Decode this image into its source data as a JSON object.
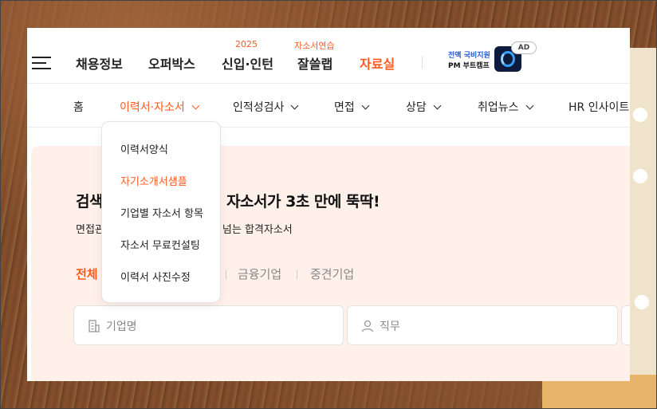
{
  "header": {
    "nav": [
      {
        "label": "채용정보",
        "tag": ""
      },
      {
        "label": "오퍼박스",
        "tag": ""
      },
      {
        "label": "신입·인턴",
        "tag": "2025"
      },
      {
        "label": "잘쓸랩",
        "tag": "자소서연습"
      },
      {
        "label": "자료실",
        "tag": ""
      }
    ],
    "ad": {
      "line1": "전액 국비지원",
      "line2": "PM 부트캠프",
      "badge": "AD"
    }
  },
  "subnav": {
    "items": [
      "홈",
      "이력서·자소서",
      "인적성검사",
      "면접",
      "상담",
      "취업뉴스",
      "HR 인사이트"
    ],
    "active_index": 1
  },
  "dropdown": {
    "items": [
      "이력서양식",
      "자기소개서샘플",
      "기업별 자소서 항목",
      "자소서 무료컨설팅",
      "이력서 사진수정"
    ],
    "active_index": 1
  },
  "hero": {
    "title_left": "검색",
    "title_right": "격 자소서가 3초 만에 뚝딱!",
    "sub_left": "면접관",
    "sub_right": "넘는 합격자소서",
    "filters": [
      "전체",
      "금융기업",
      "중견기업"
    ],
    "company_placeholder": "기업명",
    "job_placeholder": "직무"
  },
  "colors": {
    "accent": "#ff5a1f",
    "hero_bg": "#fff1e9"
  }
}
